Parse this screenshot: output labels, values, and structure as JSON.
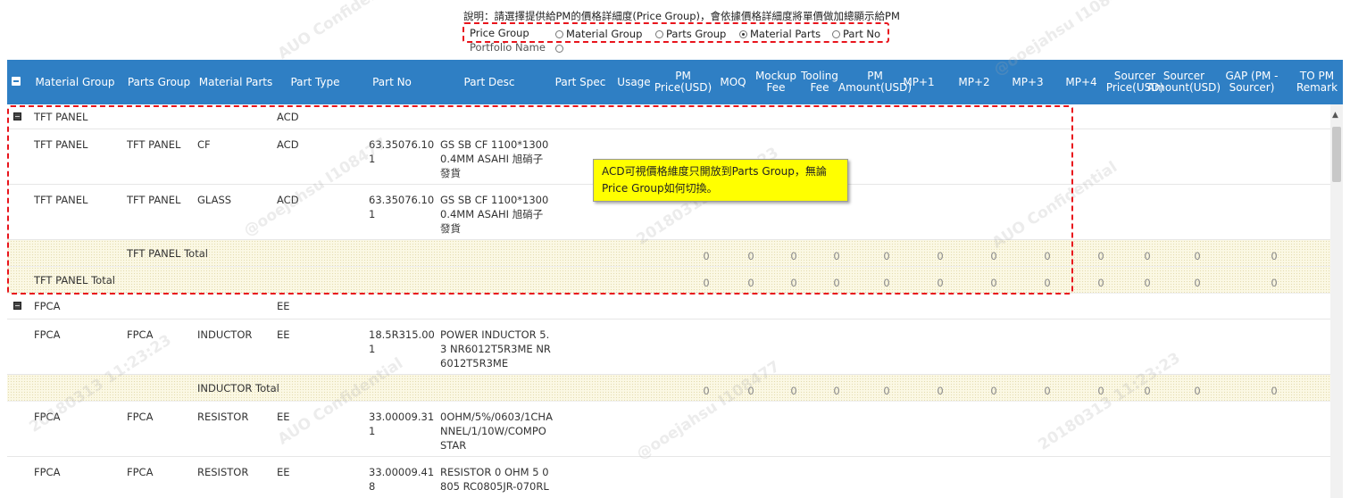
{
  "instruction": "說明：請選擇提供給PM的價格詳細度(Price Group)，會依據價格詳細度將單價做加總顯示給PM",
  "price_group": {
    "label": "Price Group",
    "options": [
      "Material Group",
      "Parts Group",
      "Material Parts",
      "Part No"
    ],
    "selected": "Material Parts"
  },
  "portfolio_label": "Portfolio Name",
  "columns": [
    "Material Group",
    "Parts Group",
    "Material Parts",
    "Part Type",
    "Part No",
    "Part Desc",
    "Part Spec",
    "Usage",
    "PM Price(USD)",
    "MOQ",
    "Mockup Fee",
    "Tooling Fee",
    "PM Amount(USD)",
    "MP+1",
    "MP+2",
    "MP+3",
    "MP+4",
    "Sourcer Price(USD)",
    "Sourcer Amount(USD)",
    "GAP (PM - Sourcer)",
    "TO PM Remark"
  ],
  "rows": [
    {
      "kind": "group",
      "material_group": "TFT PANEL",
      "part_type": "ACD"
    },
    {
      "kind": "item",
      "material_group": "TFT PANEL",
      "parts_group": "TFT PANEL",
      "material_parts": "CF",
      "part_type": "ACD",
      "part_no": "63.35076.101",
      "part_desc": "GS SB CF 1100*1300 0.4MM ASAHI 旭硝子發貨"
    },
    {
      "kind": "item",
      "material_group": "TFT PANEL",
      "parts_group": "TFT PANEL",
      "material_parts": "GLASS",
      "part_type": "ACD",
      "part_no": "63.35076.101",
      "part_desc": "GS SB CF 1100*1300 0.4MM ASAHI 旭硝子發貨"
    },
    {
      "kind": "total",
      "label": "TFT PANEL Total",
      "level": "parts_group",
      "values": [
        "0",
        "0",
        "0",
        "0",
        "0",
        "0",
        "0",
        "0",
        "0",
        "0",
        "0",
        "0"
      ]
    },
    {
      "kind": "total",
      "label": "TFT PANEL Total",
      "level": "material_group",
      "values": [
        "0",
        "0",
        "0",
        "0",
        "0",
        "0",
        "0",
        "0",
        "0",
        "0",
        "0",
        "0"
      ]
    },
    {
      "kind": "group",
      "material_group": "FPCA",
      "part_type": "EE"
    },
    {
      "kind": "item",
      "material_group": "FPCA",
      "parts_group": "FPCA",
      "material_parts": "INDUCTOR",
      "part_type": "EE",
      "part_no": "18.5R315.001",
      "part_desc": "POWER INDUCTOR 5.3 NR6012T5R3ME NR6012T5R3ME"
    },
    {
      "kind": "total",
      "label": "INDUCTOR Total",
      "level": "material_parts",
      "values": [
        "0",
        "0",
        "0",
        "0",
        "0",
        "0",
        "0",
        "0",
        "0",
        "0",
        "0",
        "0"
      ]
    },
    {
      "kind": "item",
      "material_group": "FPCA",
      "parts_group": "FPCA",
      "material_parts": "RESISTOR",
      "part_type": "EE",
      "part_no": "33.00009.311",
      "part_desc": "0OHM/5%/0603/1CHANNEL/1/10W/COMPOSTAR"
    },
    {
      "kind": "item",
      "material_group": "FPCA",
      "parts_group": "FPCA",
      "material_parts": "RESISTOR",
      "part_type": "EE",
      "part_no": "33.00009.418",
      "part_desc": "RESISTOR 0 OHM 5 0805 RC0805JR-070RL"
    }
  ],
  "annotation": "ACD可視價格維度只開放到Parts Group，無論Price Group如何切換。",
  "watermark": {
    "line1": "AUO Confidential",
    "line2": "@ooejahsu I108477",
    "line3": "20180313 11:23:23"
  },
  "colors": {
    "header_bg": "#2f7fc4",
    "highlight_border": "#e8141c",
    "note_bg": "#ffff00"
  }
}
